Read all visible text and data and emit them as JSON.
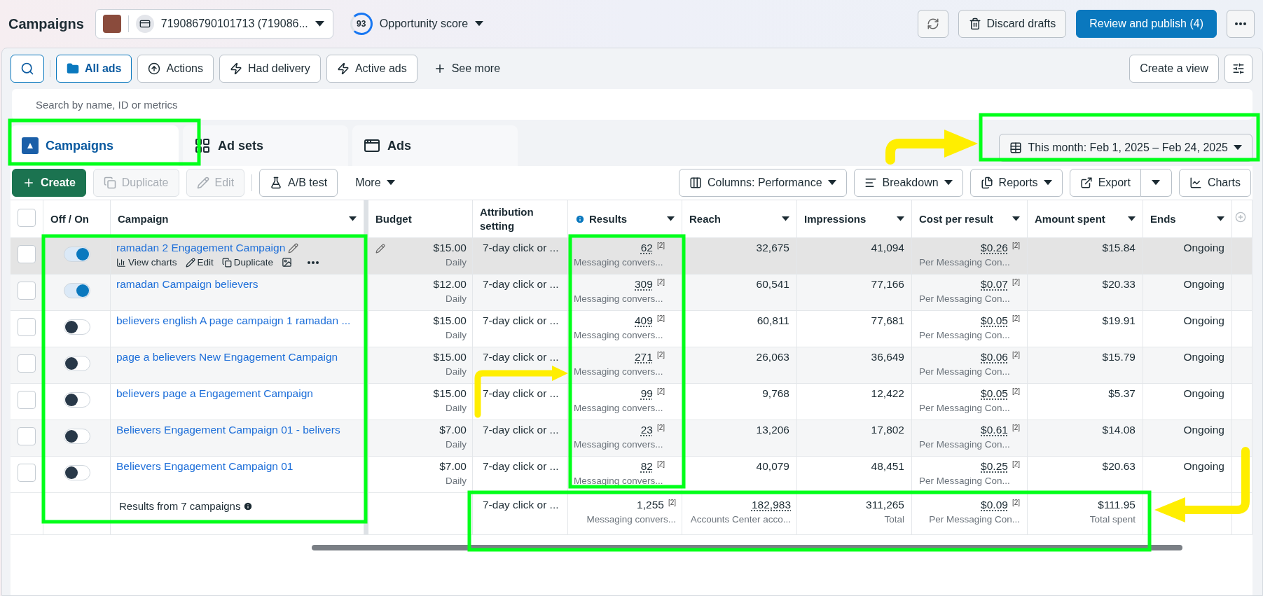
{
  "header": {
    "title": "Campaigns",
    "account": "719086790101713 (719086...",
    "opportunity": {
      "score": "93",
      "label": "Opportunity score"
    },
    "buttons": [
      "Discard drafts",
      "Review and publish (4)"
    ]
  },
  "filters": [
    {
      "label": "All ads",
      "selected": true
    },
    {
      "label": "Actions",
      "selected": false
    },
    {
      "label": "Had delivery",
      "selected": false
    },
    {
      "label": "Active ads",
      "selected": false
    }
  ],
  "see_more": "See more",
  "create_view": "Create a view",
  "search": {
    "placeholder": "Search by name, ID or metrics"
  },
  "level_tabs": [
    {
      "label": "Campaigns",
      "selected": true
    },
    {
      "label": "Ad sets",
      "selected": false
    },
    {
      "label": "Ads",
      "selected": false
    }
  ],
  "date_range": "This month: Feb 1, 2025 – Feb 24, 2025",
  "actions": [
    {
      "label": "Create",
      "kind": "primary",
      "disabled": false
    },
    {
      "label": "Duplicate",
      "kind": "plain",
      "disabled": true
    },
    {
      "label": "Edit",
      "kind": "plain",
      "disabled": true
    },
    {
      "label": "A/B test",
      "kind": "plain",
      "disabled": false
    },
    {
      "label": "More",
      "kind": "menu",
      "disabled": false
    }
  ],
  "view_buttons": [
    "Columns: Performance",
    "Breakdown",
    "Reports",
    "Export",
    "Charts"
  ],
  "table": {
    "all_checked": false,
    "columns": [
      "Off / On",
      "Campaign",
      "Budget",
      "Attribution setting",
      "Results",
      "Reach",
      "Impressions",
      "Cost per result",
      "Amount spent",
      "Ends"
    ],
    "rows": [
      {
        "checked": false,
        "on": true,
        "highlighted": true,
        "name": "ramadan 2 Engagement Campaign",
        "row_actions": [
          "View charts",
          "Edit",
          "Duplicate"
        ],
        "budget": "$15.00",
        "budget_period": "Daily",
        "attribution": "7-day click or ...",
        "results": "62",
        "results_note": "[2]",
        "result_type": "Messaging convers...",
        "reach": "32,675",
        "impressions": "41,094",
        "cost": "$0.26",
        "cost_note": "[2]",
        "cost_type": "Per Messaging Con...",
        "spent": "$15.84",
        "ends": "Ongoing"
      },
      {
        "checked": false,
        "on": true,
        "highlighted": false,
        "name": "ramadan Campaign believers",
        "budget": "$12.00",
        "budget_period": "Daily",
        "attribution": "7-day click or ...",
        "results": "309",
        "results_note": "[2]",
        "result_type": "Messaging convers...",
        "reach": "60,541",
        "impressions": "77,166",
        "cost": "$0.07",
        "cost_note": "[2]",
        "cost_type": "Per Messaging Con...",
        "spent": "$20.33",
        "ends": "Ongoing"
      },
      {
        "checked": false,
        "on": false,
        "highlighted": false,
        "name": "believers english A page campaign 1 ramadan ...",
        "budget": "$15.00",
        "budget_period": "Daily",
        "attribution": "7-day click or ...",
        "results": "409",
        "results_note": "[2]",
        "result_type": "Messaging convers...",
        "reach": "60,811",
        "impressions": "77,681",
        "cost": "$0.05",
        "cost_note": "[2]",
        "cost_type": "Per Messaging Con...",
        "spent": "$19.91",
        "ends": "Ongoing"
      },
      {
        "checked": false,
        "on": false,
        "highlighted": false,
        "name": "page a believers New Engagement Campaign",
        "budget": "$15.00",
        "budget_period": "Daily",
        "attribution": "7-day click or ...",
        "results": "271",
        "results_note": "[2]",
        "result_type": "Messaging convers...",
        "reach": "26,063",
        "impressions": "36,649",
        "cost": "$0.06",
        "cost_note": "[2]",
        "cost_type": "Per Messaging Con...",
        "spent": "$15.79",
        "ends": "Ongoing"
      },
      {
        "checked": false,
        "on": false,
        "highlighted": false,
        "name": "believers page a Engagement Campaign",
        "budget": "$15.00",
        "budget_period": "Daily",
        "attribution": "7-day click or ...",
        "results": "99",
        "results_note": "[2]",
        "result_type": "Messaging convers...",
        "reach": "9,768",
        "impressions": "12,422",
        "cost": "$0.05",
        "cost_note": "[2]",
        "cost_type": "Per Messaging Con...",
        "spent": "$5.37",
        "ends": "Ongoing"
      },
      {
        "checked": false,
        "on": false,
        "highlighted": false,
        "name": "Believers Engagement Campaign 01 - belivers",
        "budget": "$7.00",
        "budget_period": "Daily",
        "attribution": "7-day click or ...",
        "results": "23",
        "results_note": "[2]",
        "result_type": "Messaging convers...",
        "reach": "13,206",
        "impressions": "17,802",
        "cost": "$0.61",
        "cost_note": "[2]",
        "cost_type": "Per Messaging Con...",
        "spent": "$14.08",
        "ends": "Ongoing"
      },
      {
        "checked": false,
        "on": false,
        "highlighted": false,
        "name": "Believers Engagement Campaign 01",
        "budget": "$7.00",
        "budget_period": "Daily",
        "attribution": "7-day click or ...",
        "results": "82",
        "results_note": "[2]",
        "result_type": "Messaging convers...",
        "reach": "40,079",
        "impressions": "48,451",
        "cost": "$0.25",
        "cost_note": "[2]",
        "cost_type": "Per Messaging Con...",
        "spent": "$20.63",
        "ends": "Ongoing"
      }
    ],
    "totals": {
      "label": "Results from 7 campaigns",
      "attribution": "7-day click or ...",
      "results": "1,255",
      "results_note": "[2]",
      "result_type": "Messaging convers...",
      "reach": "182,983",
      "reach_type": "Accounts Center acco...",
      "impressions": "311,265",
      "impressions_type": "Total",
      "cost": "$0.09",
      "cost_note": "[2]",
      "cost_type": "Per Messaging Con...",
      "spent": "$111.95",
      "spent_type": "Total spent"
    }
  }
}
